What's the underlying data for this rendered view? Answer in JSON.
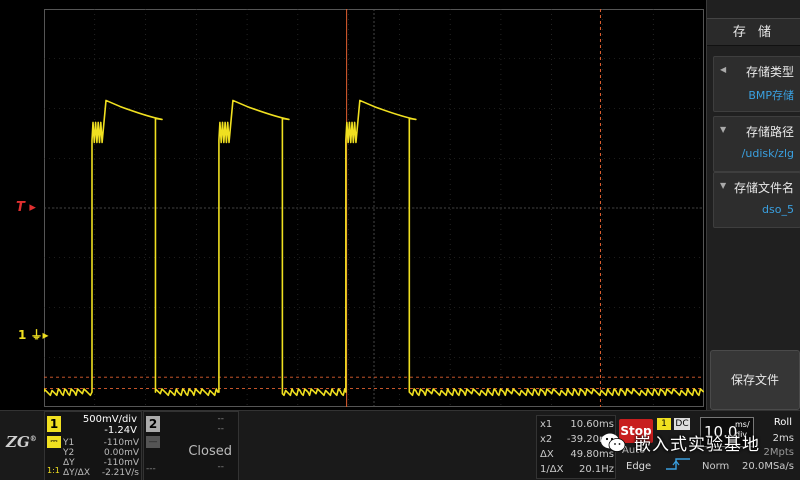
{
  "markers": {
    "trigger": "T",
    "ch1": "1"
  },
  "menu": {
    "title": "存 储",
    "items": [
      {
        "arrow": "◀",
        "label": "存储类型",
        "value": "BMP存储"
      },
      {
        "arrow": "▼",
        "label": "存储路径",
        "value": "/udisk/zlg"
      },
      {
        "arrow": "▼",
        "label": "存储文件名",
        "value": "dso_5"
      }
    ],
    "save_label": "保存文件"
  },
  "logo": {
    "text": "ZG",
    "reg": "®"
  },
  "ch1": {
    "number": "1",
    "coupling": "DC",
    "scale": "500mV/div",
    "offset": "-1.24V",
    "probe_ratio": "1:1",
    "cursors": [
      {
        "key": "Y1",
        "value": "-110mV"
      },
      {
        "key": "Y2",
        "value": "0.00mV"
      },
      {
        "key": "ΔY",
        "value": "-110mV"
      },
      {
        "key": "ΔY/ΔX",
        "value": "-2.21V/s"
      }
    ]
  },
  "ch2": {
    "number": "2",
    "coupling": "—",
    "scale": "--",
    "offset": "--",
    "status": "Closed",
    "dash": "---",
    "status2": "--"
  },
  "measurements": [
    {
      "key": "x1",
      "value": "10.60ms"
    },
    {
      "key": "x2",
      "value": "-39.20ms"
    },
    {
      "key": "ΔX",
      "value": "49.80ms"
    },
    {
      "key": "1/ΔX",
      "value": "20.1Hz"
    }
  ],
  "run_state": "Stop",
  "trigger": {
    "mode": "Auto",
    "type": "Edge",
    "source": "1",
    "coupling": "DC"
  },
  "timebase": {
    "value": "10.0",
    "unit_top": "ms/",
    "unit_bottom": "div",
    "acq_mode": "Roll",
    "delay": "2ms",
    "mem_depth": "2Mpts",
    "acq_label": "Norm",
    "sample_rate": "20.0MSa/s"
  },
  "watermark": "嵌入式实验基地",
  "colors": {
    "ch1": "#f0e020",
    "trigger": "#e03030",
    "cursor": "#e06030",
    "grid": "#3a3a3a"
  },
  "waveform": {
    "period_divs": 2.5,
    "high_level_div": 5.8,
    "low_level_div": 0.3,
    "cursor_levels_div": [
      0.6,
      0.37
    ],
    "vertical_cursor_divs": [
      6,
      11
    ]
  }
}
